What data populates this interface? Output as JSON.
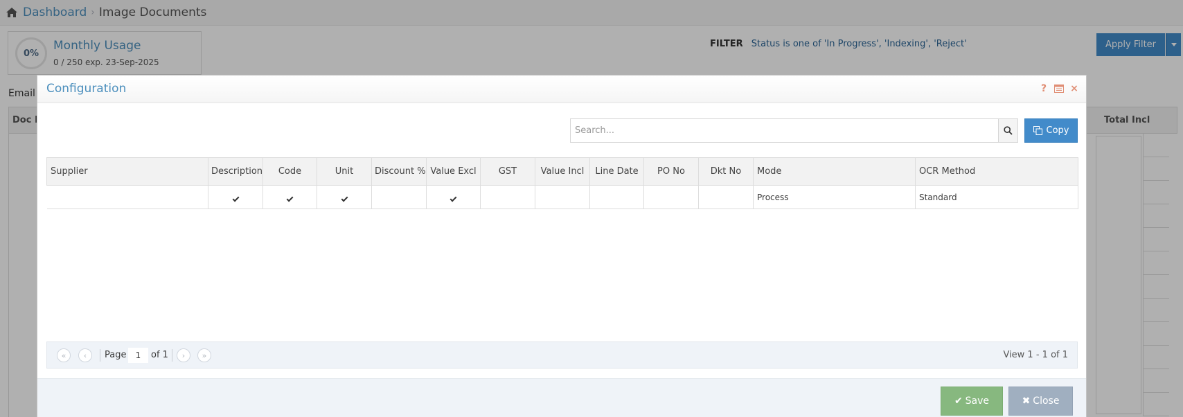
{
  "breadcrumb": {
    "home_icon": "home-icon",
    "dashboard": "Dashboard",
    "separator": "›",
    "current": "Image Documents"
  },
  "usage": {
    "percent": "0%",
    "title": "Monthly Usage",
    "detail": "0 / 250 exp. 23-Sep-2025"
  },
  "filter": {
    "label": "FILTER",
    "text": "Status is one of 'In Progress', 'Indexing', 'Reject'"
  },
  "apply_filter_label": "Apply Filter",
  "email_label": "Email /",
  "grid": {
    "doc_id_header": "Doc ID",
    "total_incl_header": "Total Incl"
  },
  "modal": {
    "title": "Configuration",
    "help_icon": "?",
    "close_icon": "×",
    "search_placeholder": "Search...",
    "copy_label": "Copy",
    "columns": [
      "Supplier",
      "Description",
      "Code",
      "Unit",
      "Discount %",
      "Value Excl",
      "GST",
      "Value Incl",
      "Line Date",
      "PO No",
      "Dkt No",
      "Mode",
      "OCR Method"
    ],
    "rows": [
      {
        "supplier": "",
        "description": true,
        "code": true,
        "unit": true,
        "discount": false,
        "value_excl": true,
        "gst": false,
        "value_incl": false,
        "line_date": false,
        "po_no": false,
        "dkt_no": false,
        "mode": "Process",
        "ocr_method": "Standard"
      }
    ],
    "pager": {
      "page_label": "Page",
      "page_value": "1",
      "of_label": "of 1",
      "view_text": "View 1 - 1 of 1"
    },
    "save_label": "Save",
    "close_label": "Close"
  },
  "colors": {
    "link": "#4c8fbd",
    "primary_button": "#428bca",
    "save_button": "#87b87f",
    "close_button": "#a0afc0",
    "title_icons": "#e08e74"
  }
}
